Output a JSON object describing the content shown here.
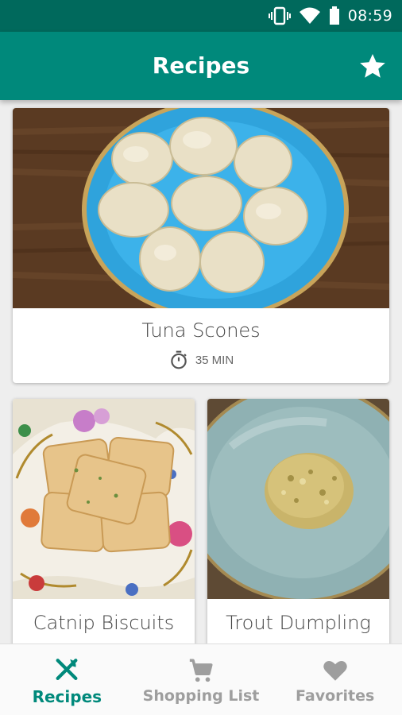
{
  "status_bar": {
    "time": "08:59",
    "icons": [
      "vibrate-icon",
      "wifi-icon",
      "battery-icon"
    ]
  },
  "app_bar": {
    "title": "Recipes",
    "action_icon": "star-icon"
  },
  "recipes": [
    {
      "title": "Tuna Scones",
      "time": "35 MIN",
      "time_icon": "timer-icon"
    },
    {
      "title": "Catnip Biscuits"
    },
    {
      "title": "Trout Dumpling"
    }
  ],
  "bottom_nav": {
    "items": [
      {
        "label": "Recipes",
        "icon": "fork-knife-icon",
        "active": true
      },
      {
        "label": "Shopping List",
        "icon": "cart-icon",
        "active": false
      },
      {
        "label": "Favorites",
        "icon": "heart-icon",
        "active": false
      }
    ]
  },
  "colors": {
    "primary": "#00897b",
    "primary_dark": "#00695c",
    "inactive": "#9e9e9e"
  }
}
